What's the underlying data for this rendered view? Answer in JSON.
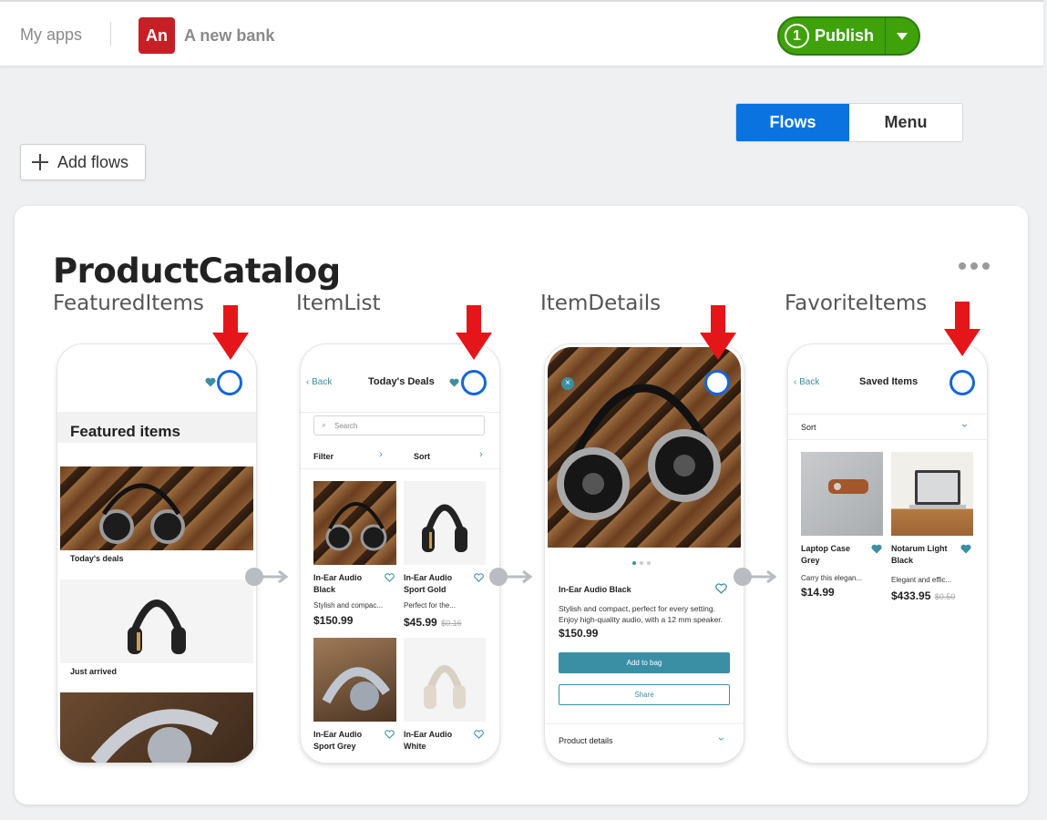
{
  "colors": {
    "brand_blue": "#0b73e0",
    "publish_green": "#3fa20a",
    "avatar_red": "#c62026",
    "teal": "#3b8fa4",
    "red_arrow": "#e4161a",
    "select_ring": "#1565d8"
  },
  "topbar": {
    "my_apps": "My apps",
    "app_initials": "An",
    "app_name": "A new bank",
    "publish_count": "1",
    "publish_label": "Publish"
  },
  "toolbar": {
    "tabs": [
      {
        "label": "Flows",
        "active": true
      },
      {
        "label": "Menu",
        "active": false
      }
    ],
    "add_flows": "Add flows"
  },
  "flow": {
    "title": "ProductCatalog",
    "screens": [
      {
        "name": "FeaturedItems",
        "heading": "Featured items",
        "sections": [
          "Today's deals",
          "Just arrived"
        ]
      },
      {
        "name": "ItemList",
        "back": "Back",
        "title": "Today's Deals",
        "search_placeholder": "Search",
        "filter": "Filter",
        "sort": "Sort",
        "items": [
          {
            "name1": "In-Ear Audio",
            "name2": "Black",
            "desc": "Stylish and compac...",
            "price": "$150.99",
            "old_price": ""
          },
          {
            "name1": "In-Ear Audio",
            "name2": "Sport Gold",
            "desc": "Perfect for the...",
            "price": "$45.99",
            "old_price": "$0.16"
          },
          {
            "name1": "In-Ear Audio",
            "name2": "Sport Grey",
            "desc": "",
            "price": "",
            "old_price": ""
          },
          {
            "name1": "In-Ear Audio",
            "name2": "White",
            "desc": "",
            "price": "",
            "old_price": ""
          }
        ]
      },
      {
        "name": "ItemDetails",
        "product_name": "In-Ear Audio Black",
        "description": "Stylish and compact, perfect for every setting. Enjoy high-quality audio, with a 12 mm speaker.",
        "price": "$150.99",
        "add_to_bag": "Add to bag",
        "share": "Share",
        "product_details": "Product details"
      },
      {
        "name": "FavoriteItems",
        "back": "Back",
        "title": "Saved Items",
        "sort": "Sort",
        "items": [
          {
            "name1": "Laptop Case",
            "name2": "Grey",
            "desc": "Carry this elegan...",
            "price": "$14.99",
            "old_price": ""
          },
          {
            "name1": "Notarum Light",
            "name2": "Black",
            "desc": "Elegant and effic...",
            "price": "$433.95",
            "old_price": "$0.50"
          }
        ]
      }
    ]
  }
}
